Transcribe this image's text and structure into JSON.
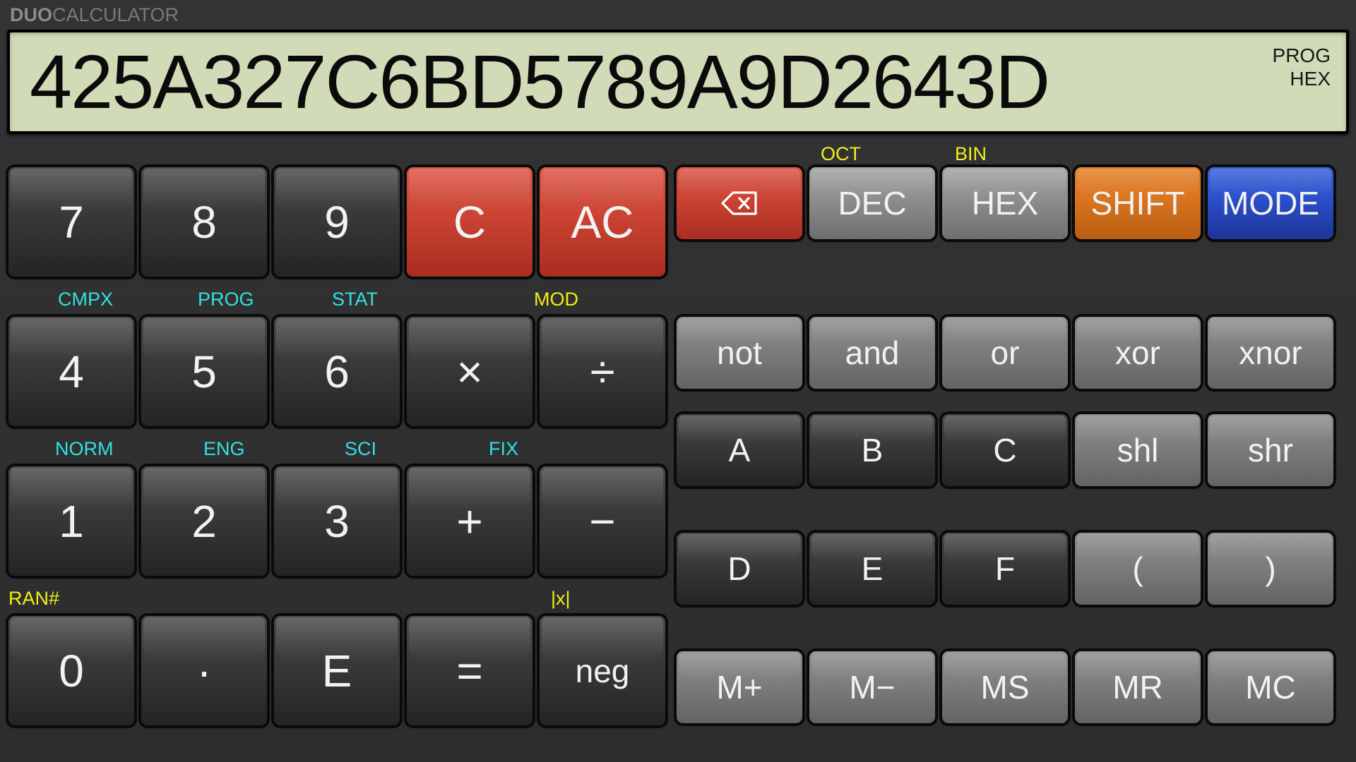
{
  "app": {
    "brand_bold": "DUO",
    "brand_light": "CALCULATOR"
  },
  "display": {
    "value": "425A327C6BD5789A9D2643D",
    "mode_indicator": "PROG",
    "base_indicator": "HEX",
    "lcd_color": "#d2dbb8",
    "text_color": "#0b0b0b"
  },
  "colors": {
    "panel": "#303030",
    "cyan_label": "#2fe2e2",
    "yellow_label": "#f2ef18",
    "red_key": "#cc4434",
    "orange_key": "#d9741f",
    "blue_key": "#2b4fc9"
  },
  "shift_labels": {
    "oct": "OCT",
    "bin": "BIN",
    "cmpx": "CMPX",
    "prog": "PROG",
    "stat": "STAT",
    "mod": "MOD",
    "norm": "NORM",
    "eng": "ENG",
    "sci": "SCI",
    "fix": "FIX",
    "ran": "RAN#",
    "abs": "|x|"
  },
  "left_keys": {
    "row1": [
      "7",
      "8",
      "9",
      "C",
      "AC"
    ],
    "row2": [
      "4",
      "5",
      "6",
      "×",
      "÷"
    ],
    "row3": [
      "1",
      "2",
      "3",
      "+",
      "−"
    ],
    "row4": [
      "0",
      "·",
      "E",
      "=",
      "neg"
    ]
  },
  "right_keys": {
    "row1": [
      "backspace-icon",
      "DEC",
      "HEX",
      "SHIFT",
      "MODE"
    ],
    "row2": [
      "not",
      "and",
      "or",
      "xor",
      "xnor"
    ],
    "row3": [
      "A",
      "B",
      "C",
      "shl",
      "shr"
    ],
    "row4": [
      "D",
      "E",
      "F",
      "(",
      ")"
    ],
    "row5": [
      "M+",
      "M−",
      "MS",
      "MR",
      "MC"
    ]
  }
}
